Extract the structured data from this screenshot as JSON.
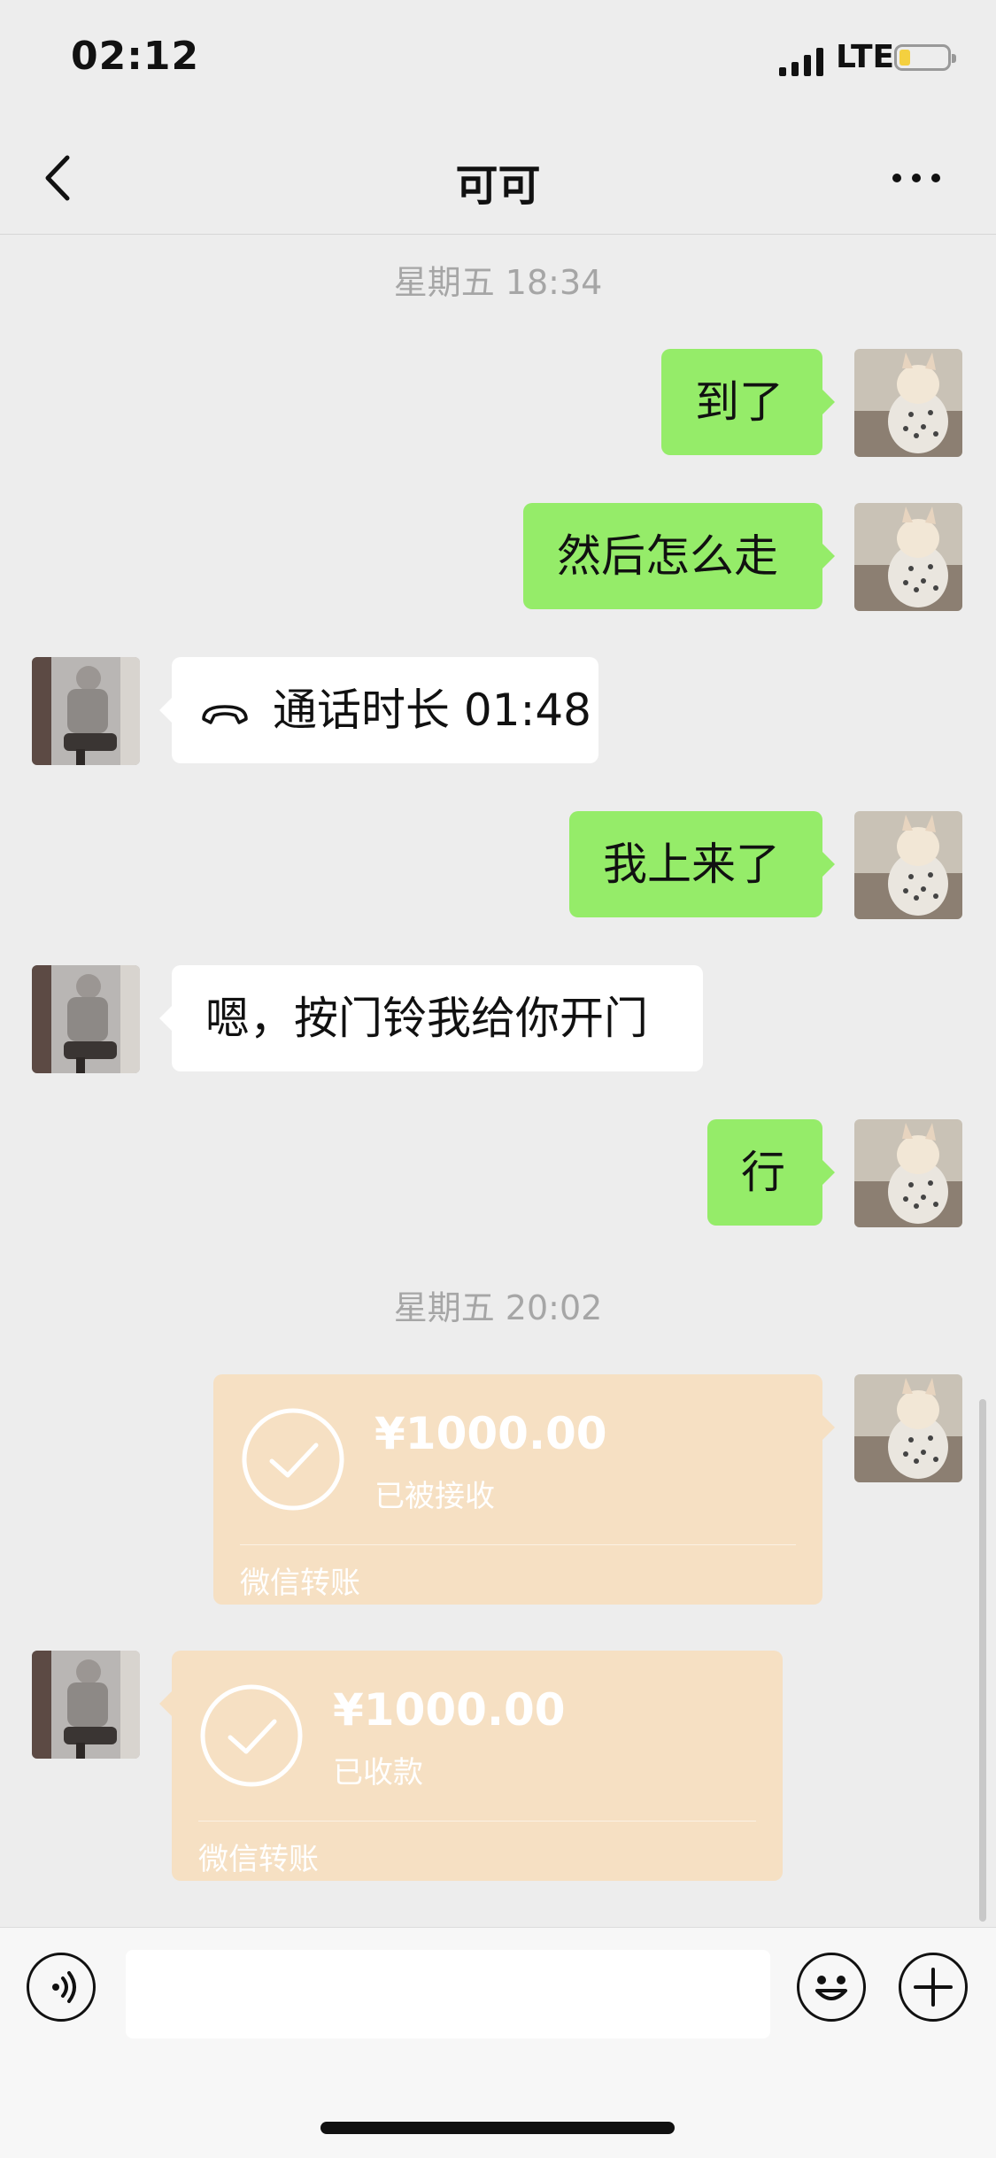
{
  "status_bar": {
    "time": "02:12",
    "network": "LTE"
  },
  "nav": {
    "title": "可可"
  },
  "messages": {
    "timestamp1": "星期五 18:34",
    "m1": "到了",
    "m2": "然后怎么走",
    "call": "通话时长 01:48",
    "m3": "我上来了",
    "m4": "嗯，按门铃我给你开门",
    "m5": "行",
    "timestamp2": "星期五 20:02",
    "transfer_out": {
      "amount": "¥1000.00",
      "status": "已被接收",
      "label": "微信转账"
    },
    "transfer_in": {
      "amount": "¥1000.00",
      "status": "已收款",
      "label": "微信转账"
    }
  },
  "input": {
    "value": "",
    "placeholder": ""
  },
  "icons": {
    "back": "chevron-left-icon",
    "more": "more-dots-icon",
    "voice": "voice-icon",
    "emoji": "emoji-icon",
    "plus": "plus-icon",
    "phone": "phone-hangup-icon",
    "check": "check-circle-icon"
  },
  "colors": {
    "background": "#ededed",
    "outgoing_bubble": "#95ec69",
    "incoming_bubble": "#ffffff",
    "transfer_card": "#f6e0c3",
    "timestamp": "#a6a6a6",
    "battery_level": "#f4d03f"
  }
}
